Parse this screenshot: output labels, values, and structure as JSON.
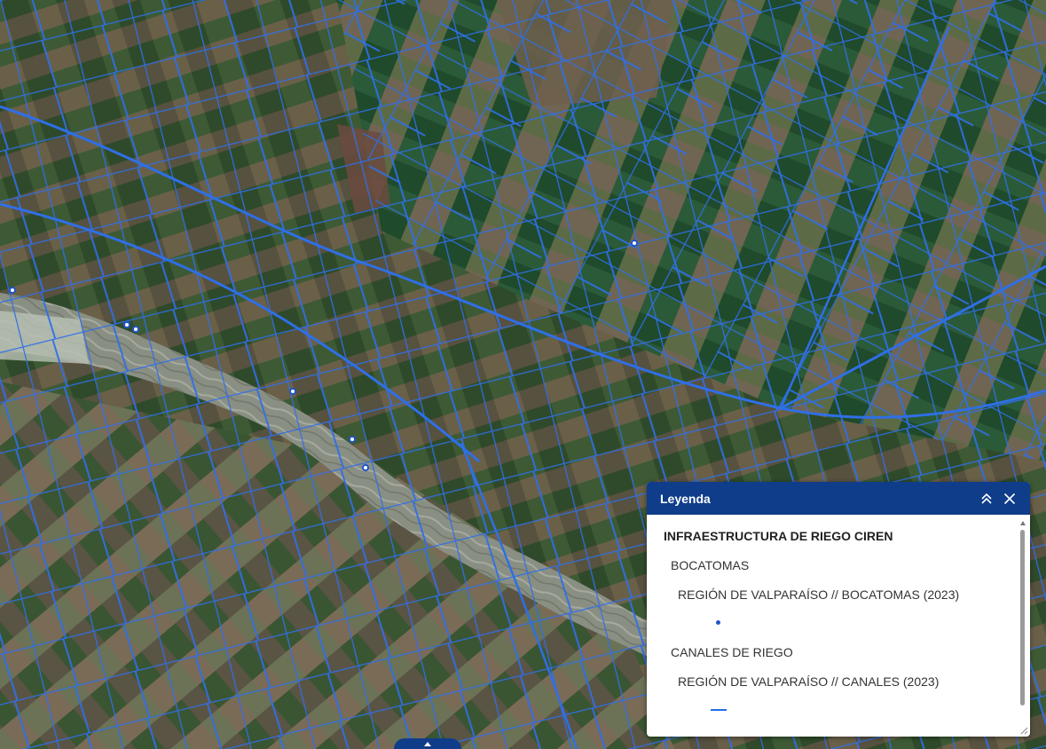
{
  "map": {
    "basemap": "satellite-imagery",
    "canal_color": "#2f6fe6",
    "bocatoma_color": "#ffffff"
  },
  "legend": {
    "title": "Leyenda",
    "header_color": "#0f3d8a",
    "group_title": "INFRAESTRUCTURA DE RIEGO CIREN",
    "sections": [
      {
        "title": "BOCATOMAS",
        "layer": "REGIÓN DE VALPARAÍSO // BOCATOMAS (2023)",
        "symbol": "point"
      },
      {
        "title": "CANALES DE RIEGO",
        "layer": "REGIÓN DE VALPARAÍSO // CANALES (2023)",
        "symbol": "line"
      }
    ],
    "collapse_icon": "double-chevron-up-icon",
    "close_icon": "close-icon"
  }
}
